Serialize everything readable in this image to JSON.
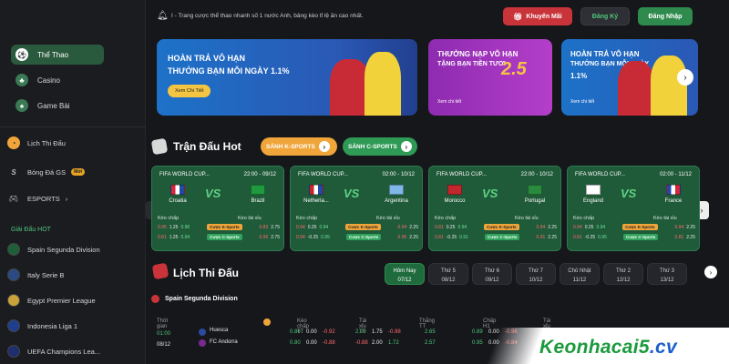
{
  "sidebar": {
    "items": [
      {
        "label": "Thể Thao",
        "icon": "soccer-ball-icon"
      },
      {
        "label": "Casino",
        "icon": "casino-chip-icon"
      },
      {
        "label": "Game Bài",
        "icon": "cards-icon"
      }
    ],
    "sections": [
      {
        "label": "Lịch Thi Đấu",
        "icon": "calendar-clock-icon"
      },
      {
        "label": "Bóng Đá GS",
        "icon": "gs-logo-icon",
        "badge": "Mới"
      },
      {
        "label": "ESPORTS",
        "icon": "gamepad-icon",
        "chevron": "›"
      }
    ],
    "hot_title": "Giải Đấu HOT",
    "leagues": [
      "Spain Segunda Division",
      "Italy Serie B",
      "Egypt Premier League",
      "Indonesia Liga 1",
      "UEFA Champions Lea..."
    ]
  },
  "topbar": {
    "notice": "I - Trang cược thể thao nhanh số 1 nước Anh, bảng kèo tỉ lệ ăn cao nhất.",
    "promo_label": "Khuyến Mãi",
    "register_label": "Đăng Ký",
    "login_label": "Đăng Nhập"
  },
  "banners": [
    {
      "line1": "HOÀN TRẢ VÔ HẠN",
      "line2": "THƯỞNG BẠN MỖI NGÀY 1.1%",
      "cta": "Xem Chi Tiết"
    },
    {
      "line1": "THƯỞNG NẠP VÔ HẠN",
      "line2": "TẶNG BẠN TIỀN TƯƠI",
      "big": "2.5",
      "cta": "Xem chi tiết"
    },
    {
      "line1": "HOÀN TRẢ VÔ HẠN",
      "line2": "THƯỞNG BẠN MỖI NGÀY",
      "line3": "1.1%",
      "cta": "Xem chi tiết"
    }
  ],
  "hot": {
    "title": "Trận Đấu Hot",
    "tab_k": "SẢNH K-SPORTS",
    "tab_c": "SẢNH C-SPORTS"
  },
  "matches": [
    {
      "league": "FIFA WORLD CUP...",
      "time": "22:00 - 09/12",
      "home": "Croatia",
      "away": "Brazil",
      "home_flag": [
        "#d7263d",
        "#ffffff",
        "#1f4aa8"
      ],
      "away_flag": "#1f9a3f",
      "k": [
        "0.95",
        "1.25",
        "0.83",
        "2.75"
      ],
      "c": [
        "0.81",
        "1.25",
        "0.96",
        "2.75"
      ],
      "k2": "0.96",
      "c2": "0.94"
    },
    {
      "league": "FIFA WORLD CUP...",
      "time": "02:00 - 10/12",
      "home": "Netherla...",
      "away": "Argentina",
      "home_flag": [
        "#c6252d",
        "#ffffff",
        "#1f4aa8"
      ],
      "away_flag": "#7fb8e6",
      "k": [
        "0.94",
        "0.25",
        "0.94",
        "2.25"
      ],
      "c": [
        "0.94",
        "-0.25",
        "0.95",
        "2.25"
      ],
      "k2": "0.94",
      "c2": "0.95"
    },
    {
      "league": "FIFA WORLD CUP...",
      "time": "22:00 - 10/12",
      "home": "Morocco",
      "away": "Portugal",
      "home_flag": "#c1272d",
      "away_flag": "#2a8a3e",
      "k": [
        "0.81",
        "0.25",
        "0.94",
        "2.25"
      ],
      "c": [
        "0.81",
        "-0.25",
        "0.91",
        "2.25"
      ],
      "k2": "0.94",
      "c2": "0.91"
    },
    {
      "league": "FIFA WORLD CUP...",
      "time": "02:00 - 11/12",
      "home": "England",
      "away": "France",
      "home_flag": "#ffffff",
      "away_flag": [
        "#1f4aa8",
        "#ffffff",
        "#d7263d"
      ],
      "k": [
        "0.94",
        "0.25",
        "0.94",
        "2.25"
      ],
      "c": [
        "0.81",
        "-0.25",
        "0.81",
        "2.25"
      ],
      "k2": "0.94",
      "c2": "0.95"
    }
  ],
  "match_labels": {
    "handicap": "Kèo chấp",
    "overunder": "Kèo tài xỉu",
    "k_sports": "Cược K-Sports",
    "c_sports": "Cược C-Sports"
  },
  "schedule": {
    "title": "Lịch Thi Đấu",
    "dates": [
      {
        "day": "Hôm Nay",
        "date": "07/12"
      },
      {
        "day": "Thứ 5",
        "date": "08/12"
      },
      {
        "day": "Thứ 6",
        "date": "09/12"
      },
      {
        "day": "Thứ 7",
        "date": "10/12"
      },
      {
        "day": "Chủ Nhật",
        "date": "11/12"
      },
      {
        "day": "Thứ 2",
        "date": "12/12"
      },
      {
        "day": "Thứ 3",
        "date": "13/12"
      }
    ],
    "league": "Spain Segunda Division",
    "headers": [
      "Thời gian",
      "Kèo chấp TT",
      "Tài xỉu TT",
      "Thắng TT",
      "Chấp H1",
      "Tài xỉu H1"
    ],
    "row": {
      "time": "01:00",
      "date": "08/12",
      "home": "Huesca",
      "away": "FC Andorra",
      "hcp_home": [
        "0.86",
        "0.00",
        "-0.92"
      ],
      "hcp_away": [
        "0.80",
        "0.00",
        "-0.88"
      ],
      "ou_home": [
        "2.00",
        "1.75",
        "-0.98"
      ],
      "ou_away": [
        "-0.88",
        "2.00",
        "1.72"
      ],
      "win_home": "2.65",
      "win_away": "2.57",
      "h1_home": [
        "0.89",
        "0.00",
        "-0.96"
      ],
      "h1_away": [
        "0.95",
        "0.00",
        "-0.84"
      ]
    }
  },
  "watermark": {
    "name": "Keonhacai5",
    "tld": ".cv"
  },
  "colors": {
    "accent_green": "#2e8b4d",
    "promo_red": "#c9343a",
    "k_orange": "#f0a53a"
  }
}
